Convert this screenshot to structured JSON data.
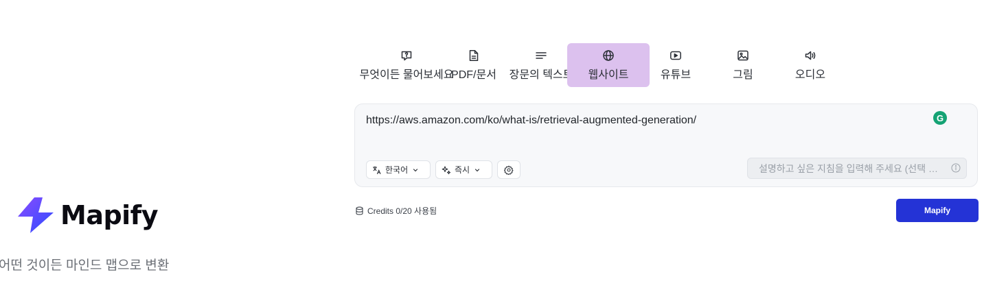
{
  "brand": {
    "name": "Mapify",
    "tagline": "어떤 것이든 마인드 맵으로 변환"
  },
  "tabs": [
    {
      "label": "무엇이든 물어보세요",
      "icon": "chat-question-icon",
      "active": false
    },
    {
      "label": "PDF/문서",
      "icon": "document-icon",
      "active": false
    },
    {
      "label": "장문의 텍스트",
      "icon": "text-lines-icon",
      "active": false
    },
    {
      "label": "웹사이트",
      "icon": "globe-icon",
      "active": true
    },
    {
      "label": "유튜브",
      "icon": "play-icon",
      "active": false
    },
    {
      "label": "그림",
      "icon": "image-icon",
      "active": false
    },
    {
      "label": "오디오",
      "icon": "audio-icon",
      "active": false
    }
  ],
  "input": {
    "url": "https://aws.amazon.com/ko/what-is/retrieval-augmented-generation/"
  },
  "options": {
    "language": "한국어",
    "mode": "즉시"
  },
  "instructions": {
    "placeholder": "설명하고 싶은 지침을 입력해 주세요 (선택 …"
  },
  "footer": {
    "credits": "Credits 0/20 사용됨",
    "submit_label": "Mapify"
  },
  "colors": {
    "accent": "#2433d6",
    "active_tab": "#dcc1ee",
    "logo_gradient": [
      "#7c4dff",
      "#2d5bff"
    ]
  }
}
